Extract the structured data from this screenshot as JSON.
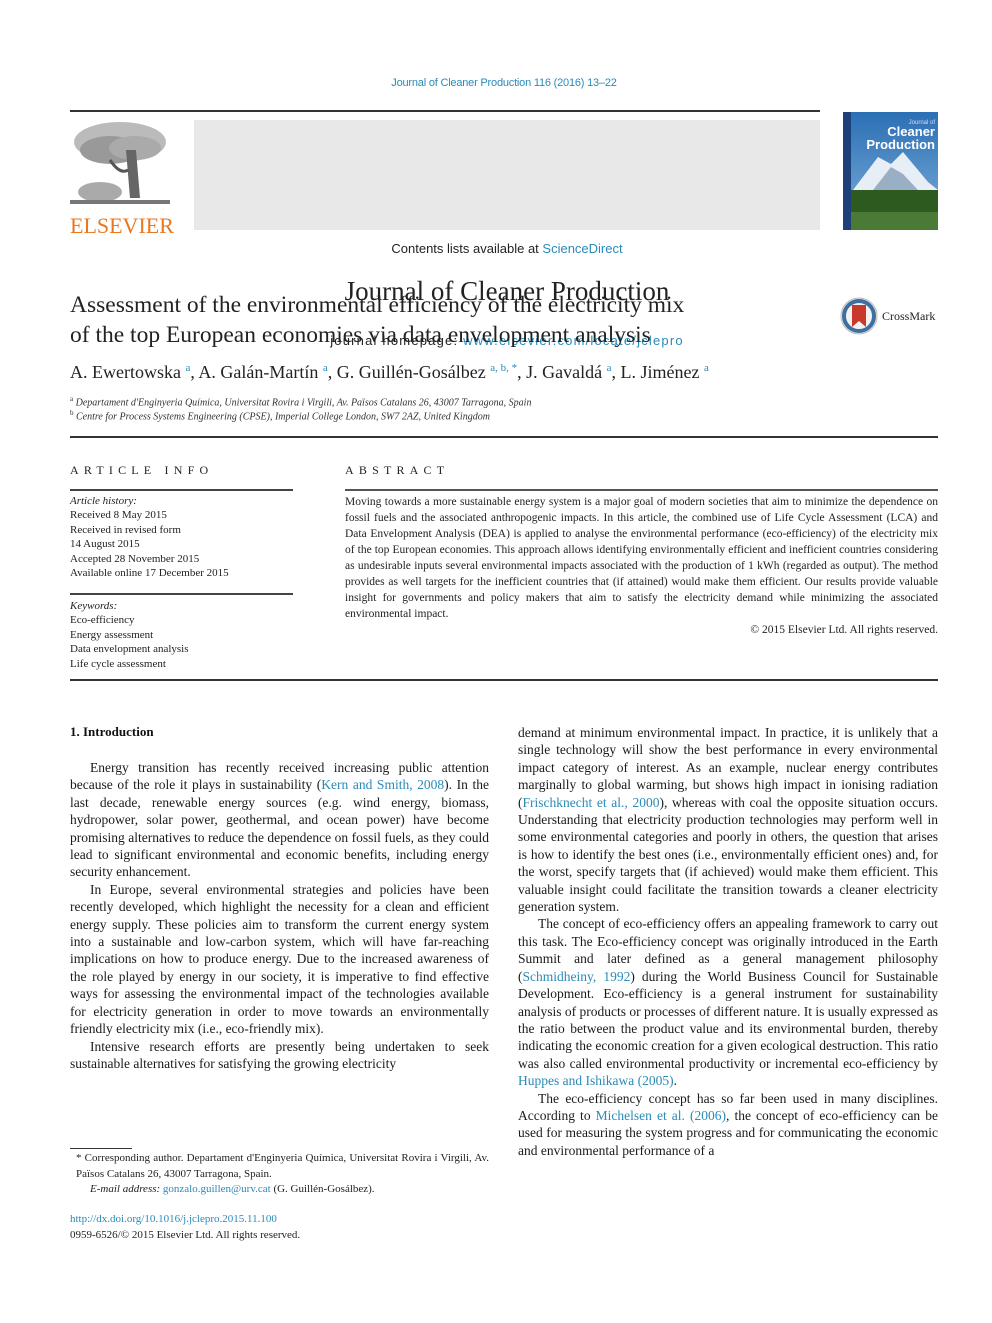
{
  "header": {
    "journal_ref": "Journal of Cleaner Production 116 (2016) 13–22",
    "contents_prefix": "Contents lists available at ",
    "contents_link": "ScienceDirect",
    "journal_title": "Journal of Cleaner Production",
    "homepage_prefix": "journal homepage: ",
    "homepage_link": "www.elsevier.com/locate/jclepro",
    "publisher_logo": "ELSEVIER",
    "cover": {
      "line1": "Journal of",
      "line2": "Cleaner",
      "line3": "Production"
    },
    "colors": {
      "link": "#2a8ab8",
      "elsevier_orange": "#e87722",
      "banner_bg": "#e8e8e8"
    }
  },
  "article": {
    "title_line1": "Assessment of the environmental efficiency of the electricity mix",
    "title_line2": "of the top European economies via data envelopment analysis",
    "crossmark_label": "CrossMark",
    "authors": [
      {
        "name": "A. Ewertowska",
        "sup": "a"
      },
      {
        "name": "A. Galán-Martín",
        "sup": "a"
      },
      {
        "name": "G. Guillén-Gosálbez",
        "sup": "a, b, *"
      },
      {
        "name": "J. Gavaldá",
        "sup": "a"
      },
      {
        "name": "L. Jiménez",
        "sup": "a"
      }
    ],
    "affiliations": [
      {
        "mark": "a",
        "text": "Departament d'Enginyeria Química, Universitat Rovira i Virgili, Av. Països Catalans 26, 43007 Tarragona, Spain"
      },
      {
        "mark": "b",
        "text": "Centre for Process Systems Engineering (CPSE), Imperial College London, SW7 2AZ, United Kingdom"
      }
    ]
  },
  "article_info": {
    "heading": "ARTICLE INFO",
    "history_label": "Article history:",
    "history": [
      "Received 8 May 2015",
      "Received in revised form",
      "14 August 2015",
      "Accepted 28 November 2015",
      "Available online 17 December 2015"
    ],
    "keywords_label": "Keywords:",
    "keywords": [
      "Eco-efficiency",
      "Energy assessment",
      "Data envelopment analysis",
      "Life cycle assessment"
    ]
  },
  "abstract": {
    "heading": "ABSTRACT",
    "text": "Moving towards a more sustainable energy system is a major goal of modern societies that aim to minimize the dependence on fossil fuels and the associated anthropogenic impacts. In this article, the combined use of Life Cycle Assessment (LCA) and Data Envelopment Analysis (DEA) is applied to analyse the environmental performance (eco-efficiency) of the electricity mix of the top European economies. This approach allows identifying environmentally efficient and inefficient countries considering as undesirable inputs several environmental impacts associated with the production of 1 kWh (regarded as output). The method provides as well targets for the inefficient countries that (if attained) would make them efficient. Our results provide valuable insight for governments and policy makers that aim to satisfy the electricity demand while minimizing the associated environmental impact.",
    "copyright": "© 2015 Elsevier Ltd. All rights reserved."
  },
  "body": {
    "section_heading": "1.  Introduction",
    "p1": {
      "before": "Energy transition has recently received increasing public attention because of the role it plays in sustainability (",
      "link": "Kern and Smith, 2008",
      "after": "). In the last decade, renewable energy sources (e.g. wind energy, biomass, hydropower, solar power, geothermal, and ocean power) have become promising alternatives to reduce the dependence on fossil fuels, as they could lead to significant environmental and economic benefits, including energy security enhancement."
    },
    "p2": "In Europe, several environmental strategies and policies have been recently developed, which highlight the necessity for a clean and efficient energy supply. These policies aim to transform the current energy system into a sustainable and low-carbon system, which will have far-reaching implications on how to produce energy. Due to the increased awareness of the role played by energy in our society, it is imperative to find effective ways for assessing the environmental impact of the technologies available for electricity generation in order to move towards an environmentally friendly electricity mix (i.e., eco-friendly mix).",
    "p3": "Intensive research efforts are presently being undertaken to seek sustainable alternatives for satisfying the growing electricity",
    "p4": {
      "before": "demand at minimum environmental impact. In practice, it is unlikely that a single technology will show the best performance in every environmental impact category of interest. As an example, nuclear energy contributes marginally to global warming, but shows high impact in ionising radiation (",
      "link": "Frischknecht et al., 2000",
      "after": "), whereas with coal the opposite situation occurs. Understanding that electricity production technologies may perform well in some environmental categories and poorly in others, the question that arises is how to identify the best ones (i.e., environmentally efficient ones) and, for the worst, specify targets that (if achieved) would make them efficient. This valuable insight could facilitate the transition towards a cleaner electricity generation system."
    },
    "p5": {
      "before": "The concept of eco-efficiency offers an appealing framework to carry out this task. The Eco-efficiency concept was originally introduced in the Earth Summit and later defined as a general management philosophy (",
      "link1": "Schmidheiny, 1992",
      "middle": ") during the World Business Council for Sustainable Development. Eco-efficiency is a general instrument for sustainability analysis of products or processes of different nature. It is usually expressed as the ratio between the product value and its environmental burden, thereby indicating the economic creation for a given ecological destruction. This ratio was also called environmental productivity or incremental eco-efficiency by ",
      "link2": "Huppes and Ishikawa (2005)",
      "after": "."
    },
    "p6": {
      "before": "The eco-efficiency concept has so far been used in many disciplines. According to ",
      "link": "Michelsen et al. (2006)",
      "after": ", the concept of eco-efficiency can be used for measuring the system progress and for communicating the economic and environmental performance of a"
    }
  },
  "footnote": {
    "corresponding": "* Corresponding author. Departament d'Enginyeria Química, Universitat Rovira i Virgili, Av. Països Catalans 26, 43007 Tarragona, Spain.",
    "email_label": "E-mail address: ",
    "email": "gonzalo.guillen@urv.cat",
    "email_owner": " (G. Guillén-Gosálbez).",
    "doi": "http://dx.doi.org/10.1016/j.jclepro.2015.11.100",
    "issn": "0959-6526/© 2015 Elsevier Ltd. All rights reserved."
  }
}
